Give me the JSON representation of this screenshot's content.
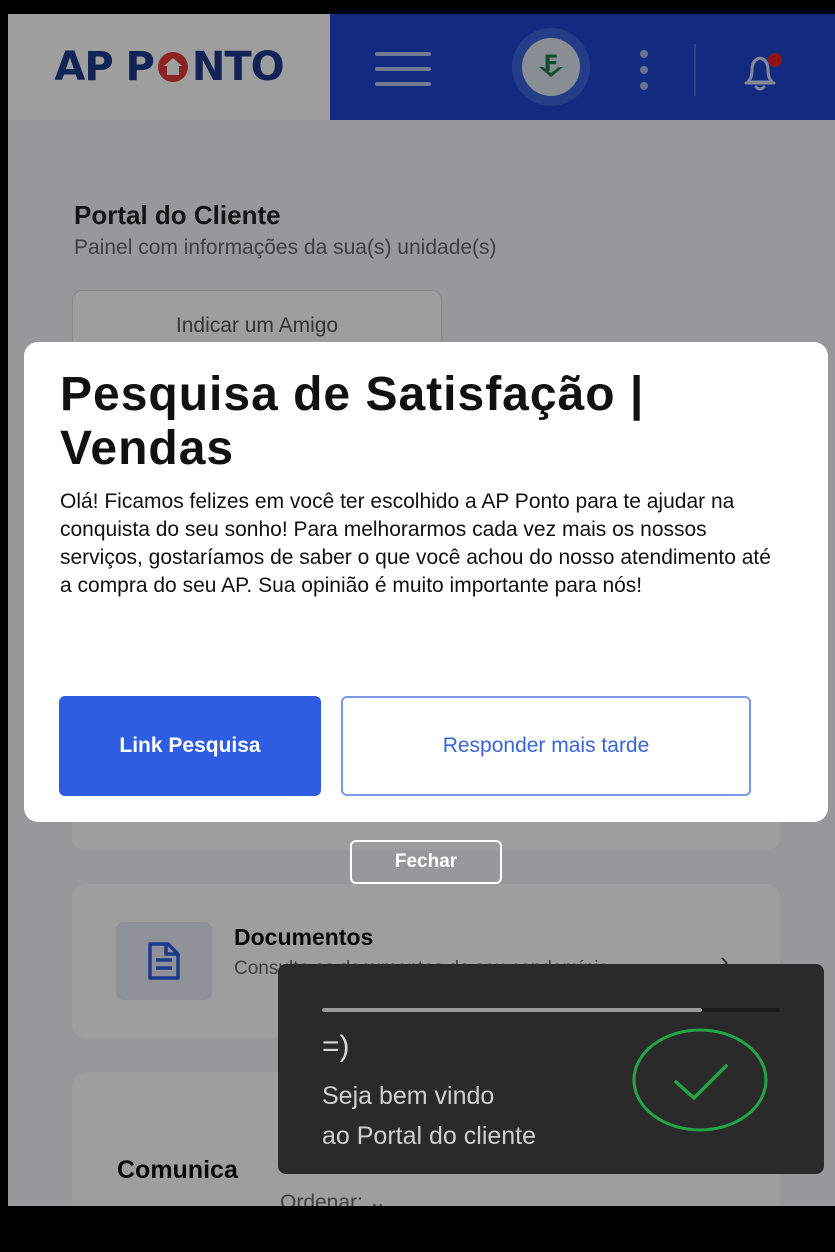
{
  "header": {
    "logo_left": "AP P",
    "logo_right": "NTO",
    "colors": {
      "logo": "#1e3a8a",
      "nav_bg": "#1d46cf",
      "logo_house": "#e23a3a"
    }
  },
  "page": {
    "title": "Portal do Cliente",
    "subtitle": "Painel com informações da sua(s) unidade(s)",
    "invite_button": "Indicar um Amigo",
    "documents": {
      "title": "Documentos",
      "subtitle": "Consulte os documentos do seu condomínio"
    },
    "communications": {
      "title": "Comunica",
      "order_label": "Ordenar:"
    }
  },
  "modal": {
    "title": "Pesquisa de Satisfação | Vendas",
    "body": "Olá!   Ficamos felizes em você ter escolhido a AP Ponto para te ajudar na conquista do seu sonho! Para melhorarmos cada vez mais os nossos serviços, gostaríamos de saber o que você achou do nosso atendimento até a compra do seu AP. Sua opinião é muito importante para nós!",
    "primary_button": "Link Pesquisa",
    "secondary_button": "Responder mais tarde",
    "close_button": "Fechar"
  },
  "toast": {
    "emoji": "=)",
    "message": "Seja bem vindo\nao Portal do cliente",
    "progress": 0.83,
    "colors": {
      "check": "#22a447"
    }
  }
}
